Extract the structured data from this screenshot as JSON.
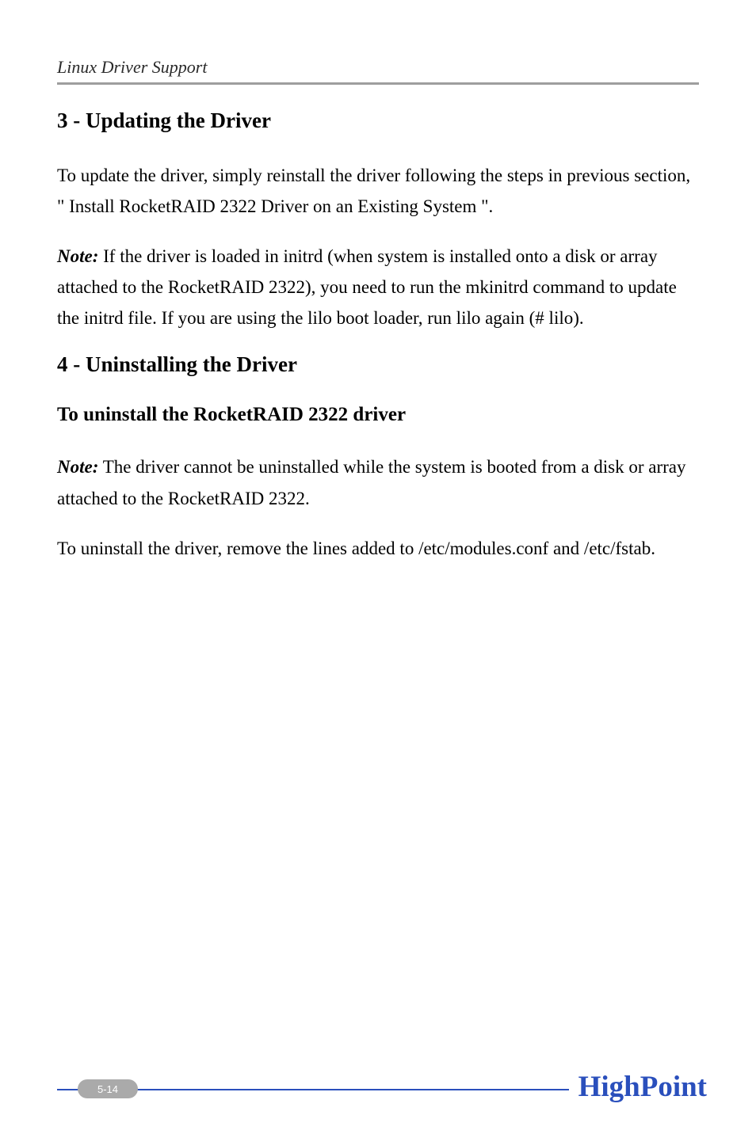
{
  "header": {
    "title": "Linux Driver Support"
  },
  "sections": {
    "s3": {
      "title": "3 - Updating the Driver",
      "p1": "To update the driver, simply reinstall the driver following the steps in previous section, \" Install RocketRAID 2322 Driver on an Existing System \".",
      "note_label": "Note:",
      "note_text": " If the driver is loaded in initrd (when system is installed onto a disk or array attached to the RocketRAID 2322), you need to run the mkinitrd command to update the initrd file. If you are using the lilo boot loader, run lilo again (# lilo)."
    },
    "s4": {
      "title": "4 - Uninstalling the Driver",
      "sub_title": "To uninstall the RocketRAID 2322 driver",
      "note_label": "Note:",
      "note_text": " The driver cannot be uninstalled while the system is booted from a disk or array attached to the RocketRAID 2322.",
      "p1": "To uninstall the driver, remove the lines added to /etc/modules.conf and /etc/fstab."
    }
  },
  "footer": {
    "page_number": "5-14",
    "logo_text": "HighPoint"
  }
}
